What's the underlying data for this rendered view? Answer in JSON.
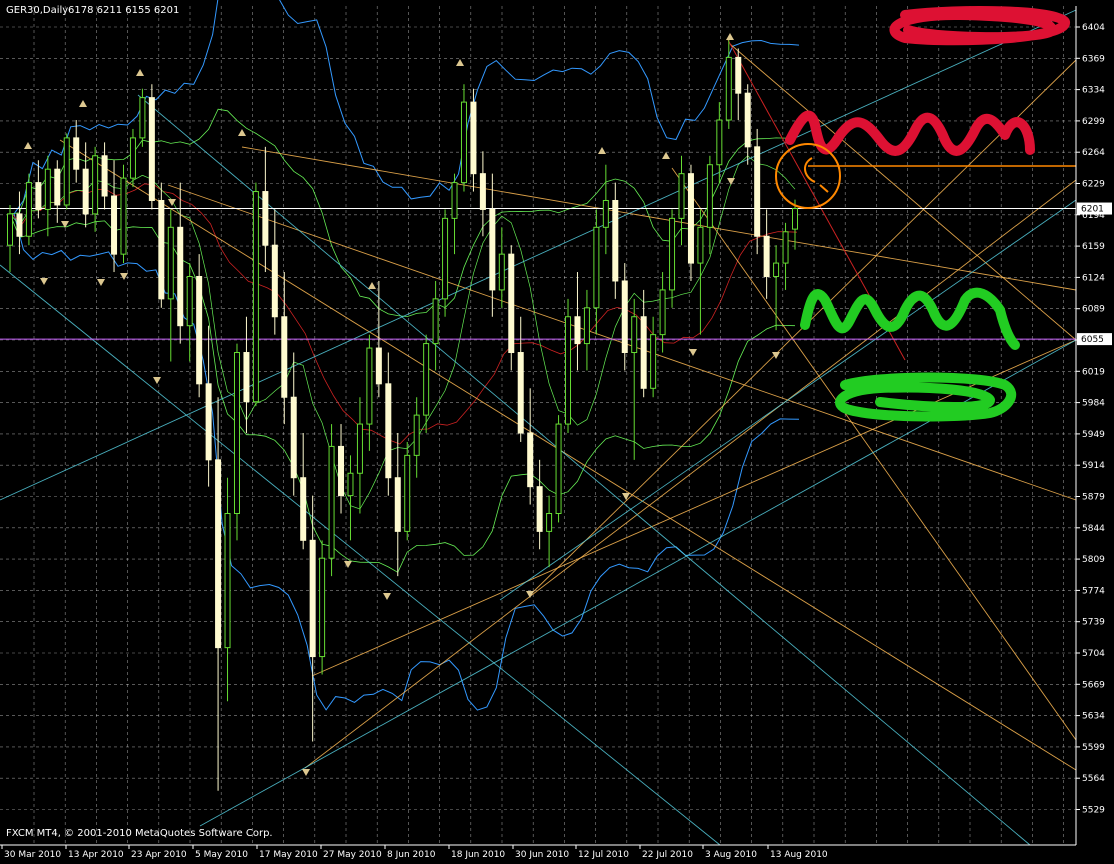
{
  "header": {
    "symbol_timeframe": "GER30,Daily",
    "ohlc": "6178 6211 6155 6201"
  },
  "footer": {
    "copyright": "FXCM MT4, © 2001-2010 MetaQuotes Software Corp."
  },
  "colors": {
    "background": "#000000",
    "grid": "#ffffff",
    "bull_candle": "#66dd33",
    "bear_candle": "#fffbd0",
    "bollinger": "#3399ff",
    "envelope": "#66ee55",
    "ma_red": "#cc2222",
    "trend_orange": "#ffbb55",
    "trend_cyan": "#55ccdd",
    "current_price_line": "#ffffff",
    "marked_price_line": "#cc66ff",
    "scribble_red": "#dd1133",
    "scribble_green": "#22cc22",
    "circle_orange": "#ff8800"
  },
  "chart_data": {
    "type": "candlestick",
    "x_ticks": [
      "30 Mar 2010",
      "13 Apr 2010",
      "23 Apr 2010",
      "5 May 2010",
      "17 May 2010",
      "27 May 2010",
      "8 Jun 2010",
      "18 Jun 2010",
      "30 Jun 2010",
      "12 Jul 2010",
      "22 Jul 2010",
      "3 Aug 2010",
      "13 Aug 2010"
    ],
    "y_ticks": [
      6404,
      6369,
      6334,
      6299,
      6264,
      6229,
      6194,
      6159,
      6124,
      6089,
      6054,
      6019,
      5984,
      5949,
      5914,
      5879,
      5844,
      5809,
      5774,
      5739,
      5704,
      5669,
      5634,
      5599,
      5564,
      5529
    ],
    "ylim": [
      5522,
      6422
    ],
    "current_price_label": "6201",
    "marked_price_label": "6055",
    "current_price": 6201,
    "marked_price": 6055,
    "candles": [
      {
        "o": 6160,
        "h": 6205,
        "l": 6130,
        "c": 6195
      },
      {
        "o": 6195,
        "h": 6220,
        "l": 6150,
        "c": 6170
      },
      {
        "o": 6170,
        "h": 6240,
        "l": 6160,
        "c": 6230
      },
      {
        "o": 6230,
        "h": 6255,
        "l": 6190,
        "c": 6200
      },
      {
        "o": 6200,
        "h": 6260,
        "l": 6170,
        "c": 6245
      },
      {
        "o": 6245,
        "h": 6255,
        "l": 6185,
        "c": 6205
      },
      {
        "o": 6205,
        "h": 6285,
        "l": 6200,
        "c": 6280
      },
      {
        "o": 6280,
        "h": 6300,
        "l": 6230,
        "c": 6245
      },
      {
        "o": 6245,
        "h": 6275,
        "l": 6180,
        "c": 6195
      },
      {
        "o": 6195,
        "h": 6270,
        "l": 6175,
        "c": 6260
      },
      {
        "o": 6260,
        "h": 6275,
        "l": 6200,
        "c": 6215
      },
      {
        "o": 6215,
        "h": 6255,
        "l": 6130,
        "c": 6150
      },
      {
        "o": 6150,
        "h": 6250,
        "l": 6140,
        "c": 6235
      },
      {
        "o": 6235,
        "h": 6290,
        "l": 6225,
        "c": 6280
      },
      {
        "o": 6280,
        "h": 6335,
        "l": 6270,
        "c": 6325
      },
      {
        "o": 6325,
        "h": 6340,
        "l": 6200,
        "c": 6210
      },
      {
        "o": 6210,
        "h": 6230,
        "l": 6090,
        "c": 6100
      },
      {
        "o": 6100,
        "h": 6200,
        "l": 6030,
        "c": 6180
      },
      {
        "o": 6180,
        "h": 6230,
        "l": 6050,
        "c": 6070
      },
      {
        "o": 6070,
        "h": 6140,
        "l": 6030,
        "c": 6125
      },
      {
        "o": 6125,
        "h": 6150,
        "l": 5990,
        "c": 6005
      },
      {
        "o": 6005,
        "h": 6070,
        "l": 5890,
        "c": 5920
      },
      {
        "o": 5920,
        "h": 5990,
        "l": 5550,
        "c": 5710
      },
      {
        "o": 5710,
        "h": 5900,
        "l": 5650,
        "c": 5860
      },
      {
        "o": 5860,
        "h": 6050,
        "l": 5830,
        "c": 6040
      },
      {
        "o": 6040,
        "h": 6080,
        "l": 5950,
        "c": 5985
      },
      {
        "o": 5985,
        "h": 6230,
        "l": 5980,
        "c": 6220
      },
      {
        "o": 6220,
        "h": 6270,
        "l": 6130,
        "c": 6160
      },
      {
        "o": 6160,
        "h": 6200,
        "l": 6060,
        "c": 6080
      },
      {
        "o": 6080,
        "h": 6130,
        "l": 5960,
        "c": 5990
      },
      {
        "o": 5990,
        "h": 6040,
        "l": 5880,
        "c": 5900
      },
      {
        "o": 5900,
        "h": 5950,
        "l": 5820,
        "c": 5830
      },
      {
        "o": 5830,
        "h": 5880,
        "l": 5605,
        "c": 5700
      },
      {
        "o": 5700,
        "h": 5830,
        "l": 5680,
        "c": 5810
      },
      {
        "o": 5810,
        "h": 5960,
        "l": 5790,
        "c": 5935
      },
      {
        "o": 5935,
        "h": 5960,
        "l": 5860,
        "c": 5880
      },
      {
        "o": 5880,
        "h": 5925,
        "l": 5830,
        "c": 5905
      },
      {
        "o": 5905,
        "h": 5990,
        "l": 5860,
        "c": 5960
      },
      {
        "o": 5960,
        "h": 6060,
        "l": 5930,
        "c": 6045
      },
      {
        "o": 6045,
        "h": 6120,
        "l": 5990,
        "c": 6005
      },
      {
        "o": 6005,
        "h": 6040,
        "l": 5880,
        "c": 5900
      },
      {
        "o": 5900,
        "h": 5950,
        "l": 5790,
        "c": 5840
      },
      {
        "o": 5840,
        "h": 5940,
        "l": 5830,
        "c": 5925
      },
      {
        "o": 5925,
        "h": 5990,
        "l": 5900,
        "c": 5970
      },
      {
        "o": 5970,
        "h": 6060,
        "l": 5950,
        "c": 6050
      },
      {
        "o": 6050,
        "h": 6120,
        "l": 6020,
        "c": 6100
      },
      {
        "o": 6100,
        "h": 6200,
        "l": 6080,
        "c": 6190
      },
      {
        "o": 6190,
        "h": 6240,
        "l": 6150,
        "c": 6230
      },
      {
        "o": 6230,
        "h": 6340,
        "l": 6220,
        "c": 6320
      },
      {
        "o": 6320,
        "h": 6335,
        "l": 6220,
        "c": 6240
      },
      {
        "o": 6240,
        "h": 6265,
        "l": 6170,
        "c": 6200
      },
      {
        "o": 6200,
        "h": 6240,
        "l": 6080,
        "c": 6110
      },
      {
        "o": 6110,
        "h": 6180,
        "l": 6090,
        "c": 6150
      },
      {
        "o": 6150,
        "h": 6160,
        "l": 6020,
        "c": 6040
      },
      {
        "o": 6040,
        "h": 6080,
        "l": 5940,
        "c": 5950
      },
      {
        "o": 5950,
        "h": 6000,
        "l": 5870,
        "c": 5890
      },
      {
        "o": 5890,
        "h": 5920,
        "l": 5820,
        "c": 5840
      },
      {
        "o": 5840,
        "h": 5880,
        "l": 5800,
        "c": 5860
      },
      {
        "o": 5860,
        "h": 5970,
        "l": 5850,
        "c": 5960
      },
      {
        "o": 5960,
        "h": 6100,
        "l": 5950,
        "c": 6080
      },
      {
        "o": 6080,
        "h": 6130,
        "l": 6020,
        "c": 6050
      },
      {
        "o": 6050,
        "h": 6110,
        "l": 6020,
        "c": 6090
      },
      {
        "o": 6090,
        "h": 6200,
        "l": 6060,
        "c": 6180
      },
      {
        "o": 6180,
        "h": 6250,
        "l": 6150,
        "c": 6210
      },
      {
        "o": 6210,
        "h": 6230,
        "l": 6100,
        "c": 6120
      },
      {
        "o": 6120,
        "h": 6140,
        "l": 6020,
        "c": 6040
      },
      {
        "o": 6040,
        "h": 6100,
        "l": 5920,
        "c": 6080
      },
      {
        "o": 6080,
        "h": 6110,
        "l": 5990,
        "c": 6000
      },
      {
        "o": 6000,
        "h": 6080,
        "l": 5990,
        "c": 6060
      },
      {
        "o": 6060,
        "h": 6130,
        "l": 6040,
        "c": 6110
      },
      {
        "o": 6110,
        "h": 6200,
        "l": 6090,
        "c": 6190
      },
      {
        "o": 6190,
        "h": 6260,
        "l": 6160,
        "c": 6240
      },
      {
        "o": 6240,
        "h": 6250,
        "l": 6120,
        "c": 6140
      },
      {
        "o": 6140,
        "h": 6200,
        "l": 6060,
        "c": 6180
      },
      {
        "o": 6180,
        "h": 6260,
        "l": 6150,
        "c": 6250
      },
      {
        "o": 6250,
        "h": 6320,
        "l": 6230,
        "c": 6300
      },
      {
        "o": 6300,
        "h": 6390,
        "l": 6290,
        "c": 6370
      },
      {
        "o": 6370,
        "h": 6380,
        "l": 6300,
        "c": 6330
      },
      {
        "o": 6330,
        "h": 6340,
        "l": 6250,
        "c": 6270
      },
      {
        "o": 6270,
        "h": 6290,
        "l": 6150,
        "c": 6170
      },
      {
        "o": 6170,
        "h": 6200,
        "l": 6100,
        "c": 6125
      },
      {
        "o": 6125,
        "h": 6160,
        "l": 6065,
        "c": 6140
      },
      {
        "o": 6140,
        "h": 6185,
        "l": 6110,
        "c": 6175
      },
      {
        "o": 6178,
        "h": 6211,
        "l": 6155,
        "c": 6201
      }
    ]
  }
}
